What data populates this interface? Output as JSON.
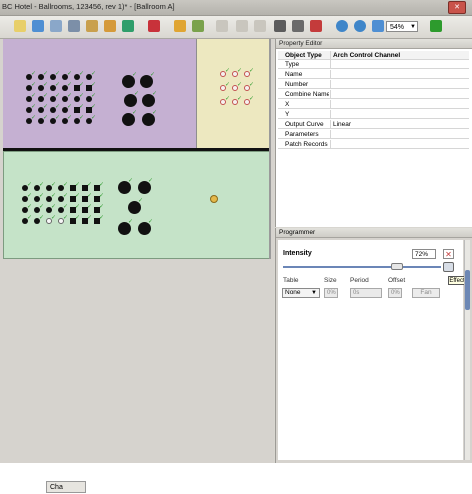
{
  "window": {
    "title": "BC Hotel - Ballrooms, 123456, rev 1)* - [Ballroom A]",
    "close_glyph": "✕"
  },
  "toolbar": {
    "zoom_value": "54%",
    "icons": [
      "new-icon",
      "open-icon",
      "save-icon",
      "print-icon",
      "user-icon",
      "palette-icon",
      "monitor-icon",
      "stop-icon",
      "wand-icon",
      "color-icon",
      "pencil-icon",
      "undo-icon",
      "delete-icon",
      "copy-icon",
      "paste-icon",
      "report-icon",
      "zoom-in-icon",
      "zoom-out-icon",
      "fit-icon",
      "run-icon"
    ]
  },
  "canvas": {
    "bottom_tab": "Cha"
  },
  "property_editor": {
    "title": "Property Editor",
    "header": {
      "key": "Object Type",
      "value": "Arch Control Channel"
    },
    "rows": [
      {
        "key": "Type",
        "value": ""
      },
      {
        "key": "Name",
        "value": ""
      },
      {
        "key": "Number",
        "value": ""
      },
      {
        "key": "Combine Name",
        "value": ""
      },
      {
        "key": "X",
        "value": ""
      },
      {
        "key": "Y",
        "value": ""
      },
      {
        "key": "Output Curve",
        "value": "Linear"
      },
      {
        "key": "Parameters",
        "value": ""
      },
      {
        "key": "Patch Records",
        "value": ""
      }
    ]
  },
  "programmer": {
    "title": "Programmer",
    "intensity_label": "Intensity",
    "intensity_value": "72%",
    "intensity_level": 0.72,
    "clear_glyph": "✕",
    "effect_tooltip": "Effect",
    "labels": {
      "table": "Table",
      "size": "Size",
      "period": "Period",
      "offset": "Offset"
    },
    "table_value": "None",
    "size_value": "0%",
    "period_value": "0s",
    "offset_value": "0%",
    "fan_label": "Fan"
  },
  "colors": {
    "room_purple": "#c5b0d2",
    "room_yellow": "#ede8c0",
    "room_green": "#c5e3c8",
    "accent_blue": "#6b86b7"
  }
}
